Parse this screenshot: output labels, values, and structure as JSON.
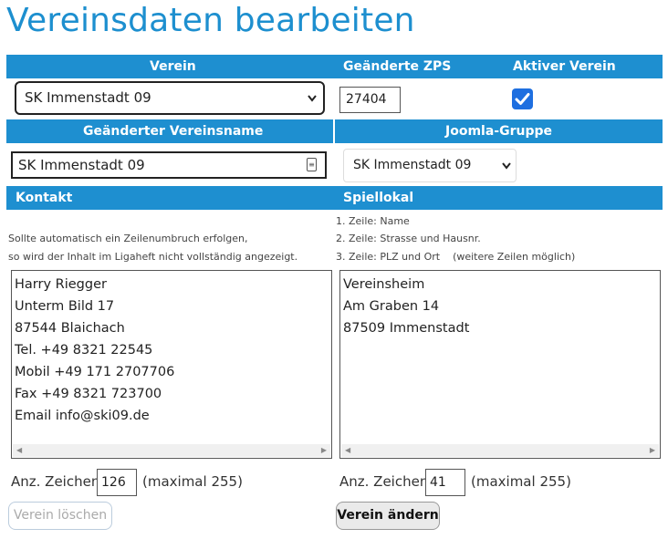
{
  "title": "Vereinsdaten bearbeiten",
  "bar1": {
    "verein": "Verein",
    "zps": "Geänderte ZPS",
    "aktiv": "Aktiver Verein"
  },
  "verein_select": "SK Immenstadt 09",
  "zps_value": "27404",
  "aktiv_checked": true,
  "bar2": {
    "vereinsname": "Geänderter Vereinsname",
    "joomla": "Joomla-Gruppe"
  },
  "vereinsname_value": "SK Immenstadt 09",
  "joomla_select": "SK Immenstadt 09",
  "bar3": {
    "kontakt": "Kontakt",
    "spiellokal": "Spiellokal"
  },
  "kontakt_note": [
    "Sollte automatisch ein Zeilenumbruch erfolgen,",
    "so wird der Inhalt im Ligaheft nicht vollständig angezeigt."
  ],
  "spiellokal_note": [
    "1. Zeile: Name",
    "2. Zeile: Strasse und Hausnr.",
    "3. Zeile: PLZ und Ort    (weitere Zeilen möglich)"
  ],
  "kontakt_lines": [
    "Harry Riegger",
    "Unterm Bild 17",
    "87544 Blaichach",
    "Tel. +49 8321 22545",
    "Mobil +49 171 2707706",
    "Fax +49 8321 723700",
    "Email info@ski09.de"
  ],
  "spiellokal_lines": [
    "Vereinsheim",
    "Am Graben 14",
    "87509 Immenstadt"
  ],
  "kontakt_count": {
    "label": "Anz. Zeichen",
    "value": "126",
    "max": "(maximal 255)"
  },
  "spiellokal_count": {
    "label": "Anz. Zeichen",
    "value": "41",
    "max": "(maximal 255)"
  },
  "buttons": {
    "delete": "Verein löschen",
    "edit": "Verein ändern"
  },
  "colors": {
    "header_bar": "#1e8fd0",
    "title": "#1d8fcf",
    "checkbox": "#1e6fe0"
  },
  "icons": {
    "select_chevron": "chevron-down-icon",
    "checkbox_check": "checkmark-icon",
    "autofill": "contact-card-icon",
    "scroll_left": "triangle-left-icon",
    "scroll_right": "triangle-right-icon"
  }
}
